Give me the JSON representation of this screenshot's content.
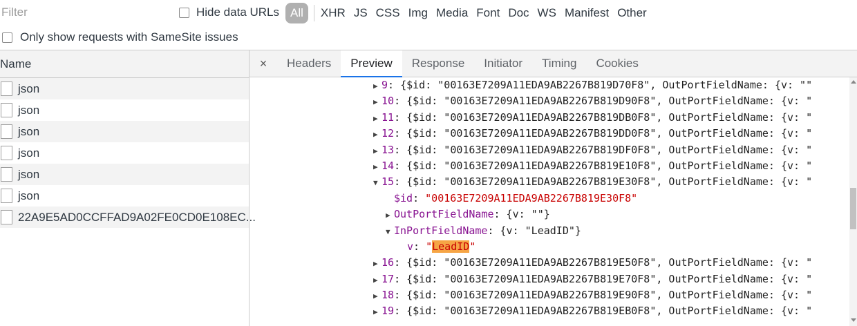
{
  "filter": {
    "placeholder": "Filter",
    "value": ""
  },
  "hide_data_urls": {
    "label": "Hide data URLs",
    "checked": false
  },
  "type_filters": [
    "All",
    "XHR",
    "JS",
    "CSS",
    "Img",
    "Media",
    "Font",
    "Doc",
    "WS",
    "Manifest",
    "Other"
  ],
  "samesite": {
    "label": "Only show requests with SameSite issues",
    "checked": false
  },
  "requests": {
    "column_header": "Name",
    "rows": [
      "json",
      "json",
      "json",
      "json",
      "json",
      "json",
      "22A9E5AD0CCFFAD9A02FE0CD0E108EC..."
    ]
  },
  "detail_tabs": {
    "close_label": "×",
    "items": [
      "Headers",
      "Preview",
      "Response",
      "Initiator",
      "Timing",
      "Cookies"
    ],
    "active": "Preview"
  },
  "preview": {
    "lines": [
      {
        "indent": 0,
        "tri": "▶",
        "key": "9",
        "rest": " {$id: \"00163E7209A11EDA9AB2267B819D70F8\", OutPortFieldName: {v: \"\""
      },
      {
        "indent": 0,
        "tri": "▶",
        "key": "10",
        "rest": " {$id: \"00163E7209A11EDA9AB2267B819D90F8\", OutPortFieldName: {v: \""
      },
      {
        "indent": 0,
        "tri": "▶",
        "key": "11",
        "rest": " {$id: \"00163E7209A11EDA9AB2267B819DB0F8\", OutPortFieldName: {v: \""
      },
      {
        "indent": 0,
        "tri": "▶",
        "key": "12",
        "rest": " {$id: \"00163E7209A11EDA9AB2267B819DD0F8\", OutPortFieldName: {v: \""
      },
      {
        "indent": 0,
        "tri": "▶",
        "key": "13",
        "rest": " {$id: \"00163E7209A11EDA9AB2267B819DF0F8\", OutPortFieldName: {v: \""
      },
      {
        "indent": 0,
        "tri": "▶",
        "key": "14",
        "rest": " {$id: \"00163E7209A11EDA9AB2267B819E10F8\", OutPortFieldName: {v: \""
      },
      {
        "indent": 0,
        "tri": "▼",
        "key": "15",
        "rest": " {$id: \"00163E7209A11EDA9AB2267B819E30F8\", OutPortFieldName: {v: \""
      },
      {
        "indent": 1,
        "tri": "",
        "key": "$id",
        "rest": " ",
        "str": "\"00163E7209A11EDA9AB2267B819E30F8\""
      },
      {
        "indent": 1,
        "tri": "▶",
        "key": "OutPortFieldName",
        "rest": " {v: \"\"}"
      },
      {
        "indent": 1,
        "tri": "▼",
        "key": "InPortFieldName",
        "rest": " {v: \"LeadID\"}"
      },
      {
        "indent": 2,
        "tri": "",
        "key": "v",
        "rest": " ",
        "str_pre": "\"",
        "str_hl": "LeadID",
        "str_post": "\""
      },
      {
        "indent": 0,
        "tri": "▶",
        "key": "16",
        "rest": " {$id: \"00163E7209A11EDA9AB2267B819E50F8\", OutPortFieldName: {v: \""
      },
      {
        "indent": 0,
        "tri": "▶",
        "key": "17",
        "rest": " {$id: \"00163E7209A11EDA9AB2267B819E70F8\", OutPortFieldName: {v: \""
      },
      {
        "indent": 0,
        "tri": "▶",
        "key": "18",
        "rest": " {$id: \"00163E7209A11EDA9AB2267B819E90F8\", OutPortFieldName: {v: \""
      },
      {
        "indent": 0,
        "tri": "▶",
        "key": "19",
        "rest": " {$id: \"00163E7209A11EDA9AB2267B819EB0F8\", OutPortFieldName: {v: \""
      }
    ]
  },
  "icons": {
    "file": "file-icon",
    "expand": "triangle-right-icon",
    "collapse": "triangle-down-icon",
    "close": "close-icon"
  },
  "colors": {
    "tab_active_underline": "#1a73e8",
    "key_purple": "#881391",
    "string_red": "#c80000",
    "search_highlight": "#f6a545"
  }
}
